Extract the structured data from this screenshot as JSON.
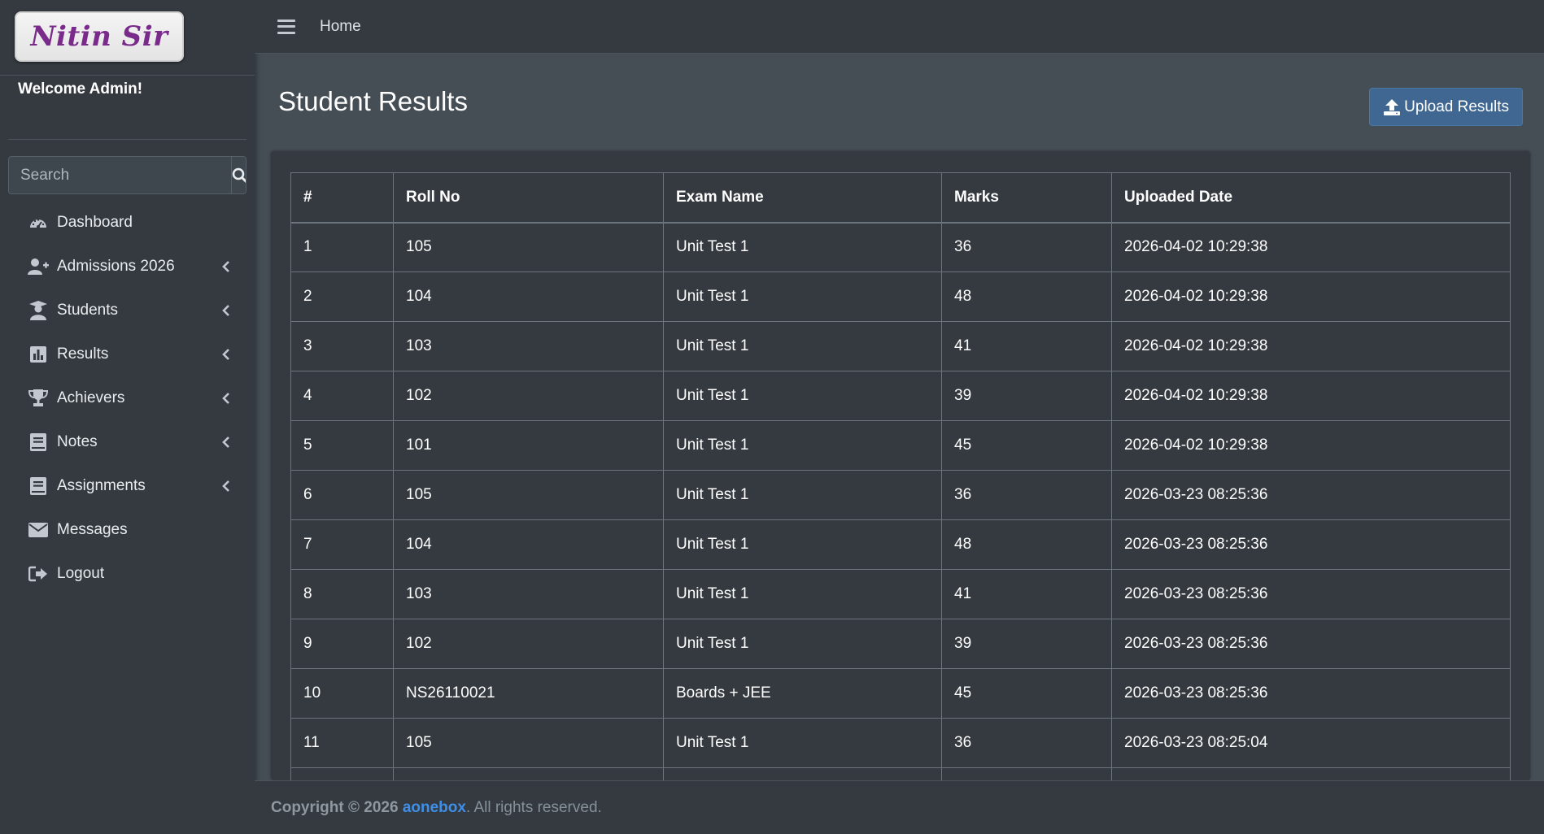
{
  "brand": {
    "logo_text": "Nitin Sir"
  },
  "sidebar": {
    "welcome": "Welcome Admin!",
    "search_placeholder": "Search",
    "items": [
      {
        "label": "Dashboard",
        "icon": "dashboard-icon",
        "has_children": false
      },
      {
        "label": "Admissions 2026",
        "icon": "user-plus-icon",
        "has_children": true
      },
      {
        "label": "Students",
        "icon": "user-graduate-icon",
        "has_children": true
      },
      {
        "label": "Results",
        "icon": "chart-bar-icon",
        "has_children": true
      },
      {
        "label": "Achievers",
        "icon": "trophy-icon",
        "has_children": true
      },
      {
        "label": "Notes",
        "icon": "book-icon",
        "has_children": true
      },
      {
        "label": "Assignments",
        "icon": "book-icon",
        "has_children": true
      },
      {
        "label": "Messages",
        "icon": "envelope-icon",
        "has_children": false
      },
      {
        "label": "Logout",
        "icon": "sign-out-icon",
        "has_children": false
      }
    ]
  },
  "topbar": {
    "home": "Home"
  },
  "main": {
    "title": "Student Results",
    "upload_label": "Upload Results",
    "table": {
      "headers": [
        "#",
        "Roll No",
        "Exam Name",
        "Marks",
        "Uploaded Date"
      ],
      "rows": [
        [
          "1",
          "105",
          "Unit Test 1",
          "36",
          "2026-04-02 10:29:38"
        ],
        [
          "2",
          "104",
          "Unit Test 1",
          "48",
          "2026-04-02 10:29:38"
        ],
        [
          "3",
          "103",
          "Unit Test 1",
          "41",
          "2026-04-02 10:29:38"
        ],
        [
          "4",
          "102",
          "Unit Test 1",
          "39",
          "2026-04-02 10:29:38"
        ],
        [
          "5",
          "101",
          "Unit Test 1",
          "45",
          "2026-04-02 10:29:38"
        ],
        [
          "6",
          "105",
          "Unit Test 1",
          "36",
          "2026-03-23 08:25:36"
        ],
        [
          "7",
          "104",
          "Unit Test 1",
          "48",
          "2026-03-23 08:25:36"
        ],
        [
          "8",
          "103",
          "Unit Test 1",
          "41",
          "2026-03-23 08:25:36"
        ],
        [
          "9",
          "102",
          "Unit Test 1",
          "39",
          "2026-03-23 08:25:36"
        ],
        [
          "10",
          "NS26110021",
          "Boards + JEE",
          "45",
          "2026-03-23 08:25:36"
        ],
        [
          "11",
          "105",
          "Unit Test 1",
          "36",
          "2026-03-23 08:25:04"
        ],
        [
          "",
          "",
          "",
          "",
          ""
        ]
      ]
    }
  },
  "footer": {
    "prefix": "Copyright © 2026",
    "link": "aonebox",
    "suffix": ". All rights reserved."
  },
  "colors": {
    "sidebar_bg": "#343a40",
    "content_bg": "#454d55",
    "accent_button": "#3f6791",
    "footer_link": "#3f8fe8"
  }
}
